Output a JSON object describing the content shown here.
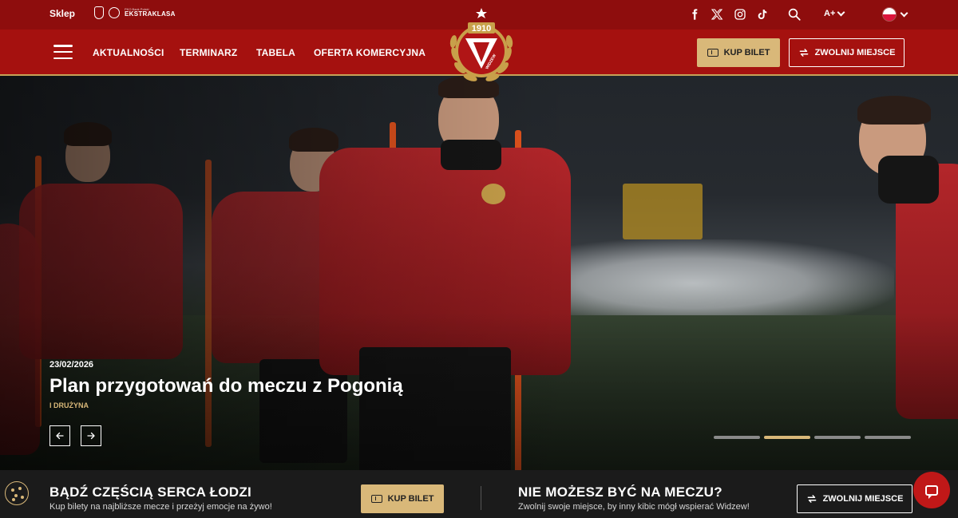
{
  "topbar": {
    "shop_label": "Sklep",
    "league_small": "PKO Bank Polski",
    "league_name": "EKSTRAKLASA",
    "social": [
      "facebook-icon",
      "x-icon",
      "instagram-icon",
      "tiktok-icon"
    ],
    "font_size_label": "A+",
    "language": "pl"
  },
  "nav": {
    "items": [
      "AKTUALNOŚCI",
      "TERMINARZ",
      "TABELA",
      "OFERTA KOMERCYJNA"
    ],
    "buy_ticket": "KUP BILET",
    "release_seat": "ZWOLNIJ MIEJSCE"
  },
  "crest": {
    "year": "1910",
    "name": "WIDZEW"
  },
  "hero": {
    "date": "23/02/2026",
    "title": "Plan przygotowań do meczu z Pogonią",
    "category": "I DRUŻYNA",
    "slides": 4,
    "active_slide": 2
  },
  "bottom": {
    "left_title": "BĄDŹ CZĘŚCIĄ SERCA ŁODZI",
    "left_sub": "Kup bilety na najbliższe mecze i przeżyj emocje na żywo!",
    "left_button": "KUP BILET",
    "right_title": "NIE MOŻESZ BYĆ NA MECZU?",
    "right_sub": "Zwolnij swoje miejsce, by inny kibic mógł wspierać Widzew!",
    "right_button": "ZWOLNIJ MIEJSCE"
  },
  "colors": {
    "topbar": "#8e0d0d",
    "navbar": "#a5110f",
    "gold": "#d9b879",
    "dark": "#1b1b1b",
    "chat": "#c01818"
  }
}
